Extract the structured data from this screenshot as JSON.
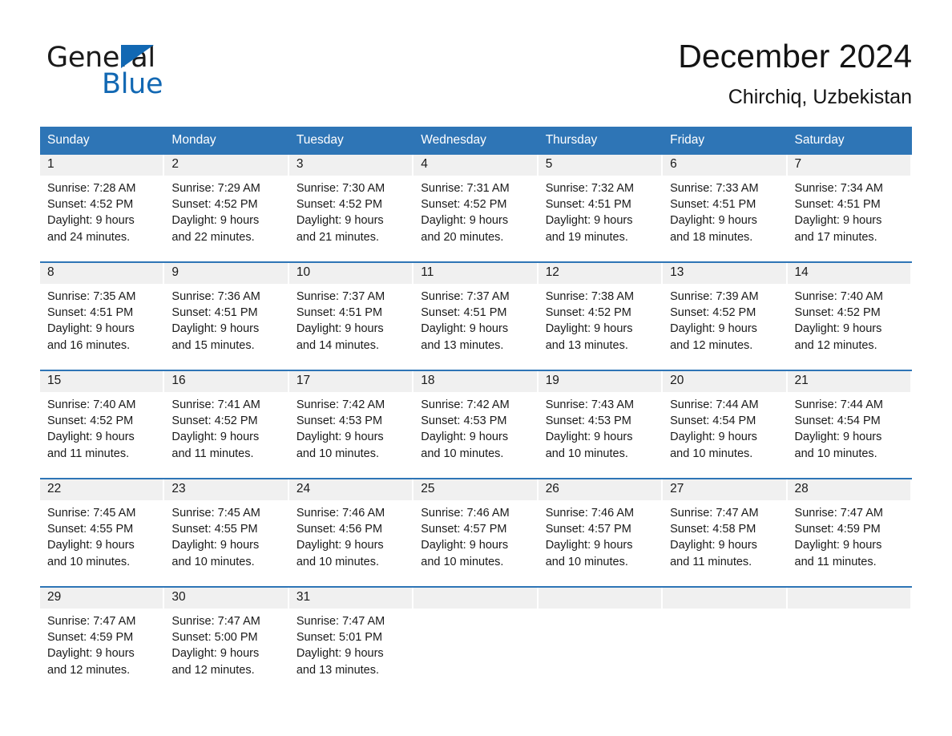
{
  "brand": {
    "name_part1": "General",
    "name_part2": "Blue",
    "accent_color": "#1268b3",
    "logo_icon": "triangle-logo-icon"
  },
  "header": {
    "title": "December 2024",
    "subtitle": "Chirchiq, Uzbekistan"
  },
  "theme": {
    "header_blue": "#2e75b6",
    "day_band_gray": "#f0f0f0",
    "text_color": "#1a1a1a"
  },
  "weekdays": [
    "Sunday",
    "Monday",
    "Tuesday",
    "Wednesday",
    "Thursday",
    "Friday",
    "Saturday"
  ],
  "weeks": [
    {
      "days": [
        {
          "day": "1",
          "sunrise": "Sunrise: 7:28 AM",
          "sunset": "Sunset: 4:52 PM",
          "daylight_line1": "Daylight: 9 hours",
          "daylight_line2": "and 24 minutes."
        },
        {
          "day": "2",
          "sunrise": "Sunrise: 7:29 AM",
          "sunset": "Sunset: 4:52 PM",
          "daylight_line1": "Daylight: 9 hours",
          "daylight_line2": "and 22 minutes."
        },
        {
          "day": "3",
          "sunrise": "Sunrise: 7:30 AM",
          "sunset": "Sunset: 4:52 PM",
          "daylight_line1": "Daylight: 9 hours",
          "daylight_line2": "and 21 minutes."
        },
        {
          "day": "4",
          "sunrise": "Sunrise: 7:31 AM",
          "sunset": "Sunset: 4:52 PM",
          "daylight_line1": "Daylight: 9 hours",
          "daylight_line2": "and 20 minutes."
        },
        {
          "day": "5",
          "sunrise": "Sunrise: 7:32 AM",
          "sunset": "Sunset: 4:51 PM",
          "daylight_line1": "Daylight: 9 hours",
          "daylight_line2": "and 19 minutes."
        },
        {
          "day": "6",
          "sunrise": "Sunrise: 7:33 AM",
          "sunset": "Sunset: 4:51 PM",
          "daylight_line1": "Daylight: 9 hours",
          "daylight_line2": "and 18 minutes."
        },
        {
          "day": "7",
          "sunrise": "Sunrise: 7:34 AM",
          "sunset": "Sunset: 4:51 PM",
          "daylight_line1": "Daylight: 9 hours",
          "daylight_line2": "and 17 minutes."
        }
      ]
    },
    {
      "days": [
        {
          "day": "8",
          "sunrise": "Sunrise: 7:35 AM",
          "sunset": "Sunset: 4:51 PM",
          "daylight_line1": "Daylight: 9 hours",
          "daylight_line2": "and 16 minutes."
        },
        {
          "day": "9",
          "sunrise": "Sunrise: 7:36 AM",
          "sunset": "Sunset: 4:51 PM",
          "daylight_line1": "Daylight: 9 hours",
          "daylight_line2": "and 15 minutes."
        },
        {
          "day": "10",
          "sunrise": "Sunrise: 7:37 AM",
          "sunset": "Sunset: 4:51 PM",
          "daylight_line1": "Daylight: 9 hours",
          "daylight_line2": "and 14 minutes."
        },
        {
          "day": "11",
          "sunrise": "Sunrise: 7:37 AM",
          "sunset": "Sunset: 4:51 PM",
          "daylight_line1": "Daylight: 9 hours",
          "daylight_line2": "and 13 minutes."
        },
        {
          "day": "12",
          "sunrise": "Sunrise: 7:38 AM",
          "sunset": "Sunset: 4:52 PM",
          "daylight_line1": "Daylight: 9 hours",
          "daylight_line2": "and 13 minutes."
        },
        {
          "day": "13",
          "sunrise": "Sunrise: 7:39 AM",
          "sunset": "Sunset: 4:52 PM",
          "daylight_line1": "Daylight: 9 hours",
          "daylight_line2": "and 12 minutes."
        },
        {
          "day": "14",
          "sunrise": "Sunrise: 7:40 AM",
          "sunset": "Sunset: 4:52 PM",
          "daylight_line1": "Daylight: 9 hours",
          "daylight_line2": "and 12 minutes."
        }
      ]
    },
    {
      "days": [
        {
          "day": "15",
          "sunrise": "Sunrise: 7:40 AM",
          "sunset": "Sunset: 4:52 PM",
          "daylight_line1": "Daylight: 9 hours",
          "daylight_line2": "and 11 minutes."
        },
        {
          "day": "16",
          "sunrise": "Sunrise: 7:41 AM",
          "sunset": "Sunset: 4:52 PM",
          "daylight_line1": "Daylight: 9 hours",
          "daylight_line2": "and 11 minutes."
        },
        {
          "day": "17",
          "sunrise": "Sunrise: 7:42 AM",
          "sunset": "Sunset: 4:53 PM",
          "daylight_line1": "Daylight: 9 hours",
          "daylight_line2": "and 10 minutes."
        },
        {
          "day": "18",
          "sunrise": "Sunrise: 7:42 AM",
          "sunset": "Sunset: 4:53 PM",
          "daylight_line1": "Daylight: 9 hours",
          "daylight_line2": "and 10 minutes."
        },
        {
          "day": "19",
          "sunrise": "Sunrise: 7:43 AM",
          "sunset": "Sunset: 4:53 PM",
          "daylight_line1": "Daylight: 9 hours",
          "daylight_line2": "and 10 minutes."
        },
        {
          "day": "20",
          "sunrise": "Sunrise: 7:44 AM",
          "sunset": "Sunset: 4:54 PM",
          "daylight_line1": "Daylight: 9 hours",
          "daylight_line2": "and 10 minutes."
        },
        {
          "day": "21",
          "sunrise": "Sunrise: 7:44 AM",
          "sunset": "Sunset: 4:54 PM",
          "daylight_line1": "Daylight: 9 hours",
          "daylight_line2": "and 10 minutes."
        }
      ]
    },
    {
      "days": [
        {
          "day": "22",
          "sunrise": "Sunrise: 7:45 AM",
          "sunset": "Sunset: 4:55 PM",
          "daylight_line1": "Daylight: 9 hours",
          "daylight_line2": "and 10 minutes."
        },
        {
          "day": "23",
          "sunrise": "Sunrise: 7:45 AM",
          "sunset": "Sunset: 4:55 PM",
          "daylight_line1": "Daylight: 9 hours",
          "daylight_line2": "and 10 minutes."
        },
        {
          "day": "24",
          "sunrise": "Sunrise: 7:46 AM",
          "sunset": "Sunset: 4:56 PM",
          "daylight_line1": "Daylight: 9 hours",
          "daylight_line2": "and 10 minutes."
        },
        {
          "day": "25",
          "sunrise": "Sunrise: 7:46 AM",
          "sunset": "Sunset: 4:57 PM",
          "daylight_line1": "Daylight: 9 hours",
          "daylight_line2": "and 10 minutes."
        },
        {
          "day": "26",
          "sunrise": "Sunrise: 7:46 AM",
          "sunset": "Sunset: 4:57 PM",
          "daylight_line1": "Daylight: 9 hours",
          "daylight_line2": "and 10 minutes."
        },
        {
          "day": "27",
          "sunrise": "Sunrise: 7:47 AM",
          "sunset": "Sunset: 4:58 PM",
          "daylight_line1": "Daylight: 9 hours",
          "daylight_line2": "and 11 minutes."
        },
        {
          "day": "28",
          "sunrise": "Sunrise: 7:47 AM",
          "sunset": "Sunset: 4:59 PM",
          "daylight_line1": "Daylight: 9 hours",
          "daylight_line2": "and 11 minutes."
        }
      ]
    },
    {
      "days": [
        {
          "day": "29",
          "sunrise": "Sunrise: 7:47 AM",
          "sunset": "Sunset: 4:59 PM",
          "daylight_line1": "Daylight: 9 hours",
          "daylight_line2": "and 12 minutes."
        },
        {
          "day": "30",
          "sunrise": "Sunrise: 7:47 AM",
          "sunset": "Sunset: 5:00 PM",
          "daylight_line1": "Daylight: 9 hours",
          "daylight_line2": "and 12 minutes."
        },
        {
          "day": "31",
          "sunrise": "Sunrise: 7:47 AM",
          "sunset": "Sunset: 5:01 PM",
          "daylight_line1": "Daylight: 9 hours",
          "daylight_line2": "and 13 minutes."
        },
        {
          "day": "",
          "sunrise": "",
          "sunset": "",
          "daylight_line1": "",
          "daylight_line2": ""
        },
        {
          "day": "",
          "sunrise": "",
          "sunset": "",
          "daylight_line1": "",
          "daylight_line2": ""
        },
        {
          "day": "",
          "sunrise": "",
          "sunset": "",
          "daylight_line1": "",
          "daylight_line2": ""
        },
        {
          "day": "",
          "sunrise": "",
          "sunset": "",
          "daylight_line1": "",
          "daylight_line2": ""
        }
      ]
    }
  ]
}
